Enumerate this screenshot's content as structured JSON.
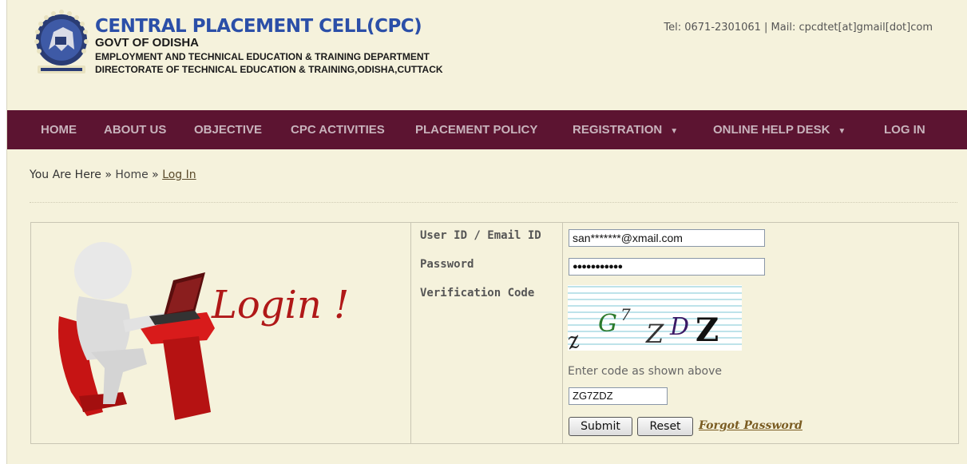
{
  "header": {
    "title": "CENTRAL PLACEMENT CELL(CPC)",
    "subtitle": "GOVT OF ODISHA",
    "department": "EMPLOYMENT AND TECHNICAL EDUCATION & TRAINING DEPARTMENT",
    "directorate": "DIRECTORATE OF TECHNICAL EDUCATION & TRAINING,ODISHA,CUTTACK",
    "contact": "Tel: 0671-2301061 | Mail: cpcdtet[at]gmail[dot]com"
  },
  "nav": {
    "items": [
      {
        "label": "HOME"
      },
      {
        "label": "ABOUT US"
      },
      {
        "label": "OBJECTIVE"
      },
      {
        "label": "CPC ACTIVITIES"
      },
      {
        "label": "PLACEMENT POLICY"
      },
      {
        "label": "REGISTRATION"
      },
      {
        "label": "ONLINE HELP DESK"
      },
      {
        "label": "LOG IN"
      }
    ]
  },
  "breadcrumb": {
    "prefix": "You Are Here",
    "sep": "»",
    "home": "Home",
    "current": "Log In"
  },
  "login": {
    "illustration_text": "Login !",
    "labels": {
      "user": "User ID / Email ID",
      "password": "Password",
      "verification": "Verification Code"
    },
    "user_value": "san*******@xmail.com",
    "password_value": "●●●●●●●●●●●",
    "captcha_text": "ZG7ZDZ",
    "hint": "Enter code as shown above",
    "code_value": "ZG7ZDZ",
    "submit_label": "Submit",
    "reset_label": "Reset",
    "forgot_label": "Forgot Password"
  },
  "colors": {
    "nav_bg": "#5c1431",
    "page_bg": "#f5f2dc",
    "title_blue": "#2b4fa8"
  }
}
